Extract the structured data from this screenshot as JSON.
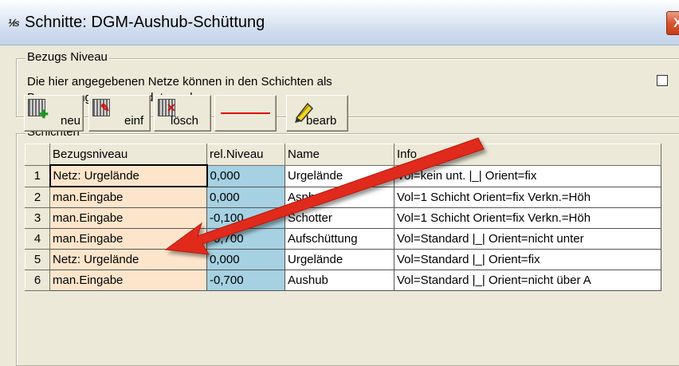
{
  "window": {
    "icon_glyph": "⅟ıs",
    "title": "Schnitte: DGM-Aushub-Schüttung",
    "close_glyph": "X"
  },
  "bezug_group": {
    "legend": "Bezugs Niveau",
    "text_line1": "Die hier angegebenen Netze können  in den Schichten als",
    "text_line2": "Begrenzungen verwendet werden"
  },
  "schichten_group": {
    "legend": "Schichten"
  },
  "toolbar": {
    "neu_label": "neu",
    "einf_label": "einf",
    "losch_label": "lösch",
    "bearb_label": "bearb",
    "line_color": "#e01010"
  },
  "table": {
    "columns": [
      "Bezugsniveau",
      "rel.Niveau",
      "Name",
      "Info"
    ],
    "rows": [
      {
        "num": "1",
        "bezug": "Netz: Urgelände",
        "rel": "0,000",
        "name": "Urgelände",
        "info": "Vol=kein unt. |_| Orient=fix"
      },
      {
        "num": "2",
        "bezug": "man.Eingabe",
        "rel": "0,000",
        "name": "Asphalt",
        "info": "Vol=1 Schicht Orient=fix Verkn.=Höh"
      },
      {
        "num": "3",
        "bezug": "man.Eingabe",
        "rel": "-0,100",
        "name": "Schotter",
        "info": "Vol=1 Schicht Orient=fix Verkn.=Höh"
      },
      {
        "num": "4",
        "bezug": "man.Eingabe",
        "rel": "-0,700",
        "name": "Aufschüttung",
        "info": "Vol=Standard  |_| Orient=nicht unter"
      },
      {
        "num": "5",
        "bezug": "Netz: Urgelände",
        "rel": "0,000",
        "name": "Urgelände",
        "info": "Vol=Standard  |_| Orient=fix"
      },
      {
        "num": "6",
        "bezug": "man.Eingabe",
        "rel": "-0,700",
        "name": "Aushub",
        "info": "Vol=Standard  |_| Orient=nicht über A"
      }
    ]
  },
  "colors": {
    "bezug_column": "#fde5cc",
    "rel_column": "#a6d1e2",
    "annotation_arrow": "#e02a1a",
    "window_face": "#ECE9D8"
  }
}
